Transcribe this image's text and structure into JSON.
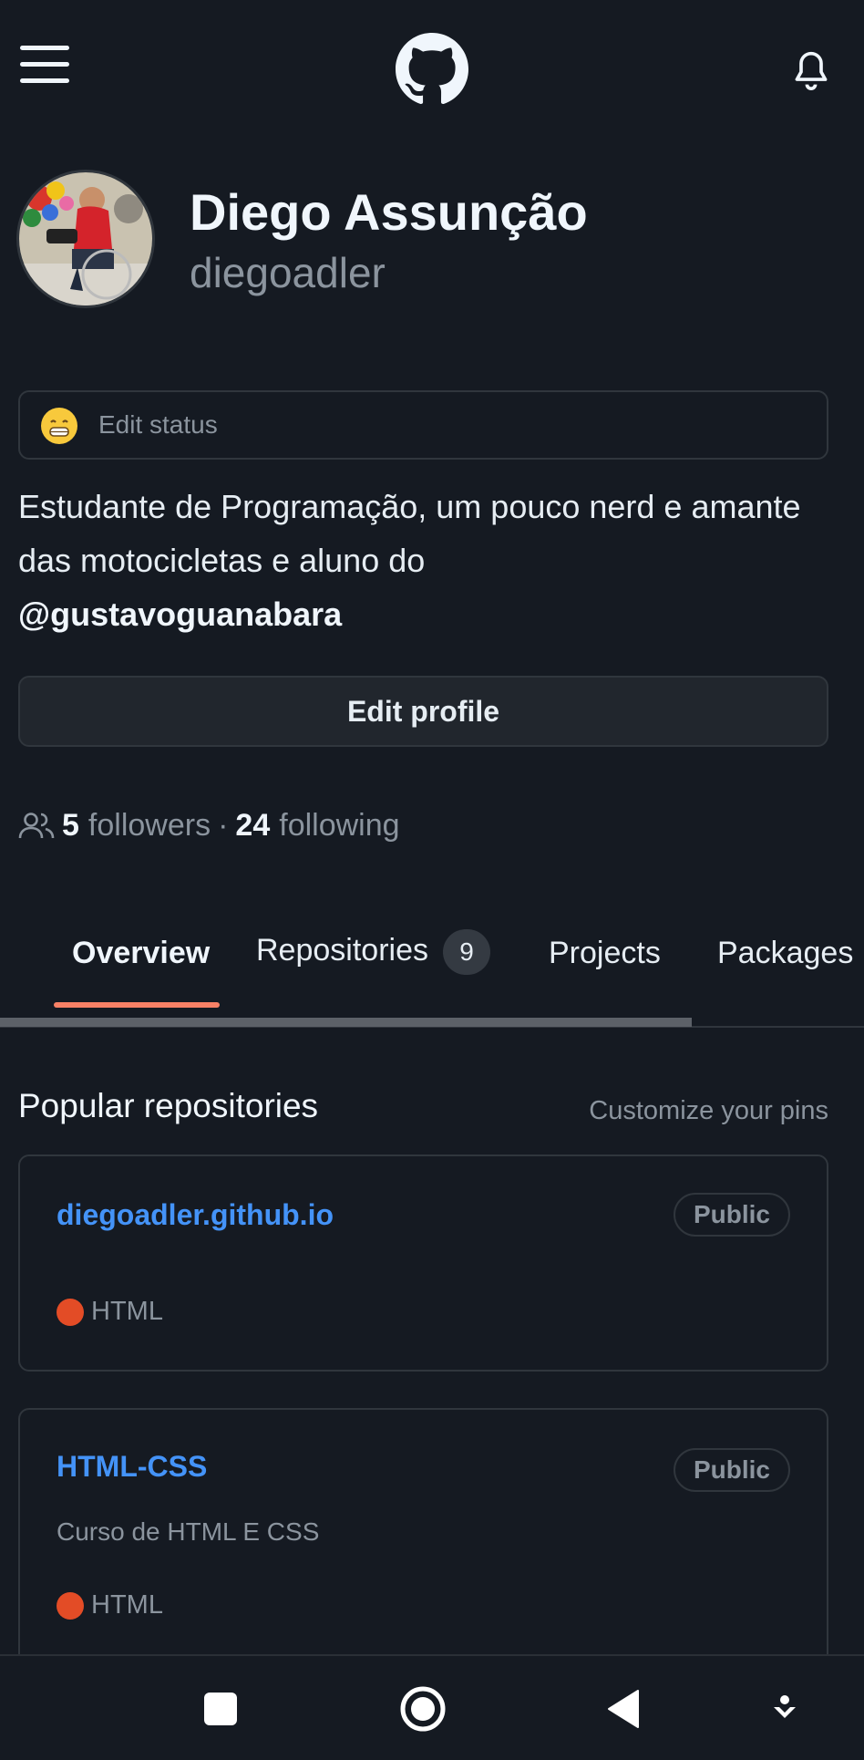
{
  "header": {
    "menu_icon": "hamburger-menu-icon",
    "logo_icon": "github-octocat-icon",
    "notifications_icon": "bell-icon"
  },
  "profile": {
    "name": "Diego Assunção",
    "login": "diegoadler",
    "status_placeholder": "Edit status",
    "status_emoji": "grinning-face-emoji",
    "bio_text": "Estudante de Programação, um pouco nerd e amante das motocicletas e aluno do",
    "bio_mention": "@gustavoguanabara",
    "edit_button": "Edit profile",
    "followers_count": "5",
    "followers_label": "followers",
    "separator": "·",
    "following_count": "24",
    "following_label": "following"
  },
  "tabs": [
    {
      "label": "Overview",
      "active": true
    },
    {
      "label": "Repositories",
      "count": "9"
    },
    {
      "label": "Projects"
    },
    {
      "label": "Packages"
    }
  ],
  "popular": {
    "title": "Popular repositories",
    "customize_link": "Customize your pins",
    "repos": [
      {
        "name": "diegoadler.github.io",
        "visibility": "Public",
        "description": "",
        "language": "HTML",
        "language_color": "#e34c26"
      },
      {
        "name": "HTML-CSS",
        "visibility": "Public",
        "description": "Curso de HTML E CSS",
        "language": "HTML",
        "language_color": "#e34c26"
      }
    ]
  },
  "system_nav": {
    "recents_icon": "square-recents-icon",
    "home_icon": "circle-home-icon",
    "back_icon": "triangle-back-icon",
    "extra_icon": "download-arrow-icon"
  },
  "colors": {
    "background": "#151a22",
    "border": "#30363d",
    "link": "#4493f8",
    "tab_underline": "#f78166"
  }
}
